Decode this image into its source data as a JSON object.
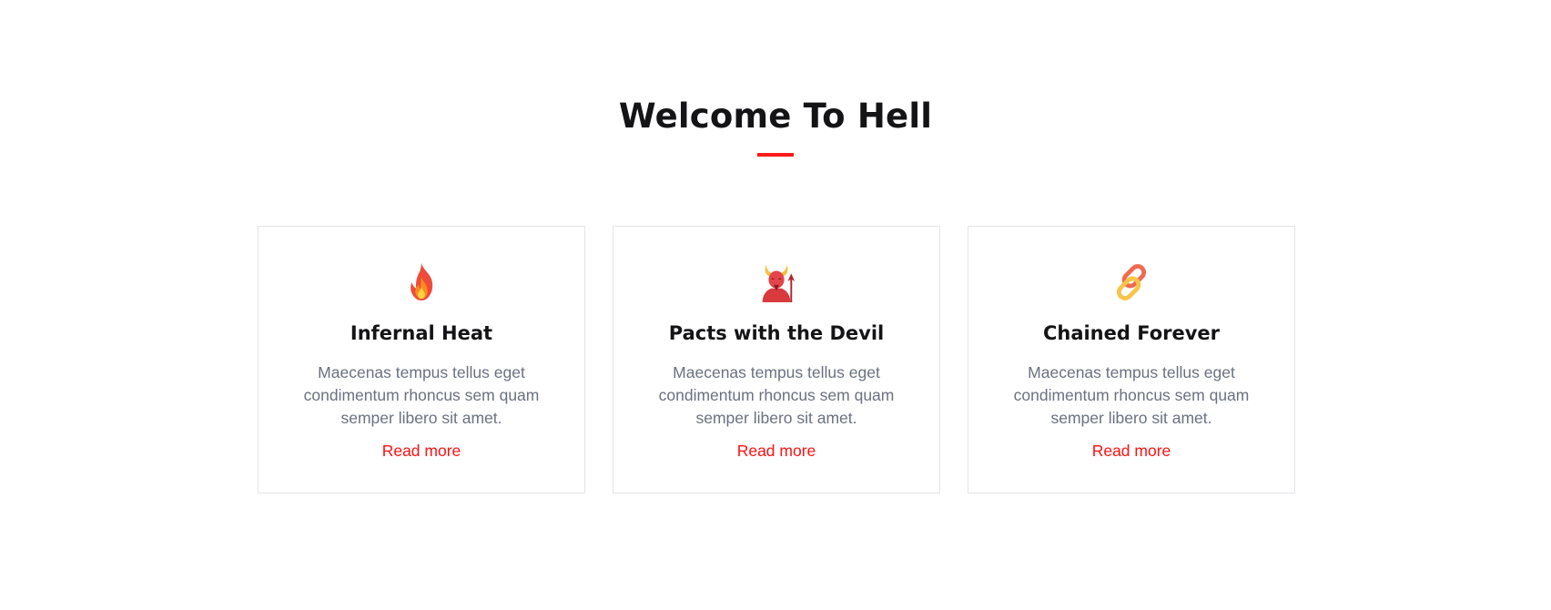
{
  "section": {
    "title": "Welcome To Hell",
    "accent_color": "#ff1a1a"
  },
  "cards": [
    {
      "icon": "fire-icon",
      "title": "Infernal Heat",
      "text": "Maecenas tempus tellus eget condimentum rhoncus sem quam semper libero sit amet.",
      "link_label": "Read more"
    },
    {
      "icon": "devil-icon",
      "title": "Pacts with the Devil",
      "text": "Maecenas tempus tellus eget condimentum rhoncus sem quam semper libero sit amet.",
      "link_label": "Read more"
    },
    {
      "icon": "chain-icon",
      "title": "Chained Forever",
      "text": "Maecenas tempus tellus eget condimentum rhoncus sem quam semper libero sit amet.",
      "link_label": "Read more"
    }
  ]
}
